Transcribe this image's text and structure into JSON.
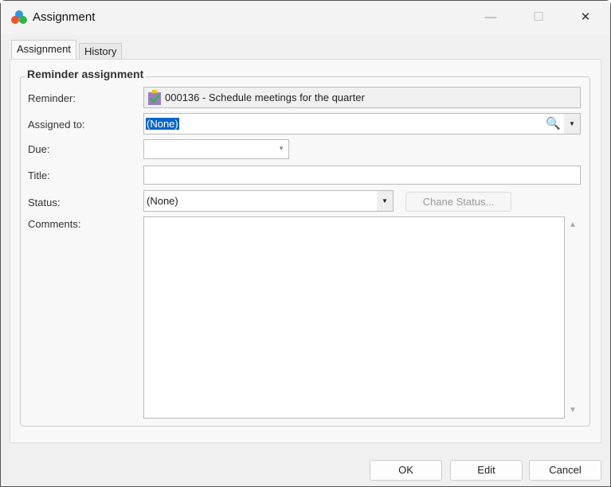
{
  "window": {
    "title": "Assignment",
    "minimize": "—",
    "maximize": "☐",
    "close": "✕"
  },
  "tabs": [
    "Assignment",
    "History"
  ],
  "group": {
    "legend": "Reminder assignment"
  },
  "labels": {
    "reminder": "Reminder:",
    "assigned_to": "Assigned to:",
    "due": "Due:",
    "title": "Title:",
    "status": "Status:",
    "comments": "Comments:"
  },
  "fields": {
    "reminder": "000136 - Schedule meetings for the quarter",
    "assigned_to": "(None)",
    "due": "",
    "title": "",
    "status": "(None)",
    "comments": ""
  },
  "buttons": {
    "change_status": "Chane Status...",
    "ok": "OK",
    "edit": "Edit",
    "cancel": "Cancel"
  }
}
